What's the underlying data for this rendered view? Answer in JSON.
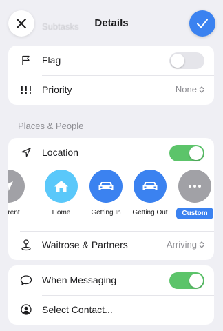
{
  "header": {
    "title": "Details",
    "ghost_label": "Subtasks",
    "close_icon": "close-icon",
    "done_icon": "checkmark-icon",
    "accent": "#3b82f0"
  },
  "flag_card": {
    "flag": {
      "label": "Flag",
      "icon": "flag-icon",
      "enabled": false
    },
    "priority": {
      "label": "Priority",
      "icon": "priority-icon",
      "value": "None"
    }
  },
  "places_header": "Places & People",
  "location_card": {
    "location": {
      "label": "Location",
      "icon": "location-arrow-icon",
      "enabled": true
    },
    "presets": [
      {
        "label": "Current",
        "icon": "location-arrow-icon",
        "color": "#a1a1a6"
      },
      {
        "label": "Home",
        "icon": "home-icon",
        "color": "#5ac8fa"
      },
      {
        "label": "Getting In",
        "icon": "car-icon",
        "color": "#3b82f0"
      },
      {
        "label": "Getting Out",
        "icon": "car-icon",
        "color": "#3b82f0"
      },
      {
        "label": "Custom",
        "icon": "ellipsis-icon",
        "color": "#a1a1a6",
        "selected": true
      }
    ],
    "place": {
      "label": "Waitrose & Partners",
      "icon": "map-pin-icon",
      "value": "Arriving"
    }
  },
  "messaging_card": {
    "when_messaging": {
      "label": "When Messaging",
      "icon": "message-bubble-icon",
      "enabled": true
    },
    "select_contact": {
      "label": "Select Contact...",
      "icon": "person-circle-icon"
    }
  },
  "colors": {
    "toggle_on": "#5cc46a",
    "toggle_off": "#e5e5ea",
    "background": "#efeff4"
  }
}
